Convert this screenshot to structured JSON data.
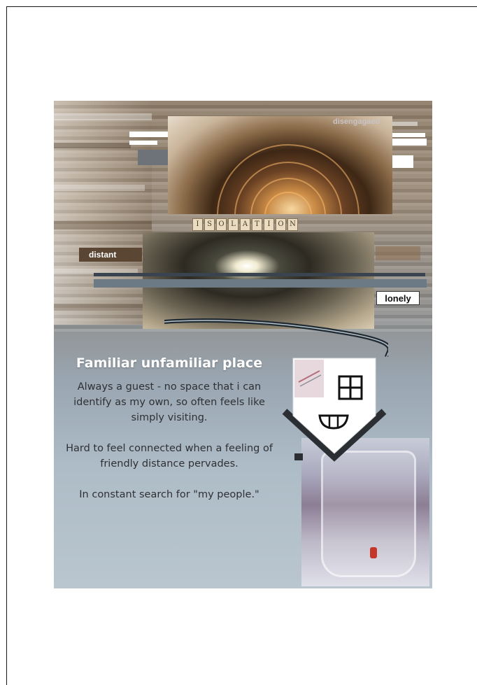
{
  "collage": {
    "corner_word": "disengagaed",
    "tiles_word": [
      "I",
      "S",
      "O",
      "L",
      "A",
      "T",
      "I",
      "O",
      "N"
    ],
    "tags": {
      "left": "distant",
      "right": "lonely"
    },
    "text": {
      "heading": "Familiar unfamiliar place",
      "para1": "Always a guest - no space that i can identify as my own, so often feels like simply visiting.",
      "para2": "Hard to feel connected when a feeling of friendly distance pervades.",
      "para3": "In constant search for \"my people.\""
    },
    "colors": {
      "tag_left_bg": "#5a4632",
      "tag_left_text": "#ffffff",
      "tag_right_bg": "#ffffff",
      "tag_right_text": "#111111",
      "heading_color": "#ffffff",
      "house_fill": "#ffffff",
      "house_roof_line": "#2b2f33"
    },
    "icons": {
      "house": "house-face-icon",
      "window": "window-icon",
      "smile": "smile-icon"
    }
  }
}
